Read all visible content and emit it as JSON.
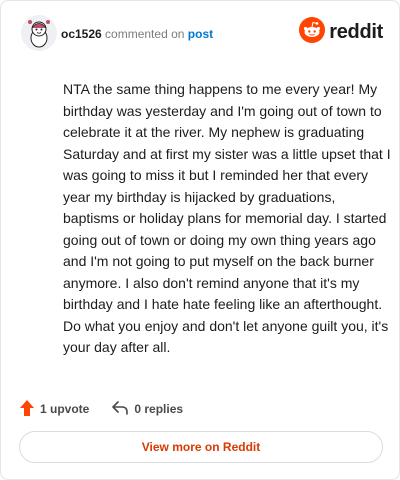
{
  "comment": {
    "username": "oc1526",
    "action_text": "commented on",
    "post_link_label": "post",
    "avatar_icon": "snoo-avatar-icon",
    "body": "NTA the same thing happens to me every year! My birthday was yesterday and I'm going out of town to celebrate it at the river. My nephew is graduating Saturday and at first my sister was a little upset that I was going to miss it but I reminded her that every year my birthday is hijacked by graduations, baptisms or holiday plans for memorial day. I started going out of town or doing my own thing years ago and I'm not going to put myself on the back burner anymore. I also don't remind anyone that it's my birthday and I hate hate feeling like an afterthought. Do what you enjoy and don't let anyone guilt you, it's your day after all."
  },
  "brand": {
    "name": "reddit",
    "icon": "reddit-logo-icon",
    "color": "#ff4500"
  },
  "actions": {
    "upvote_label": "1 upvote",
    "upvote_icon": "upvote-arrow-icon",
    "reply_label": "0 replies",
    "reply_icon": "reply-arrow-icon"
  },
  "footer": {
    "view_more_label": "View more on Reddit",
    "accent_color": "#d93a00"
  }
}
